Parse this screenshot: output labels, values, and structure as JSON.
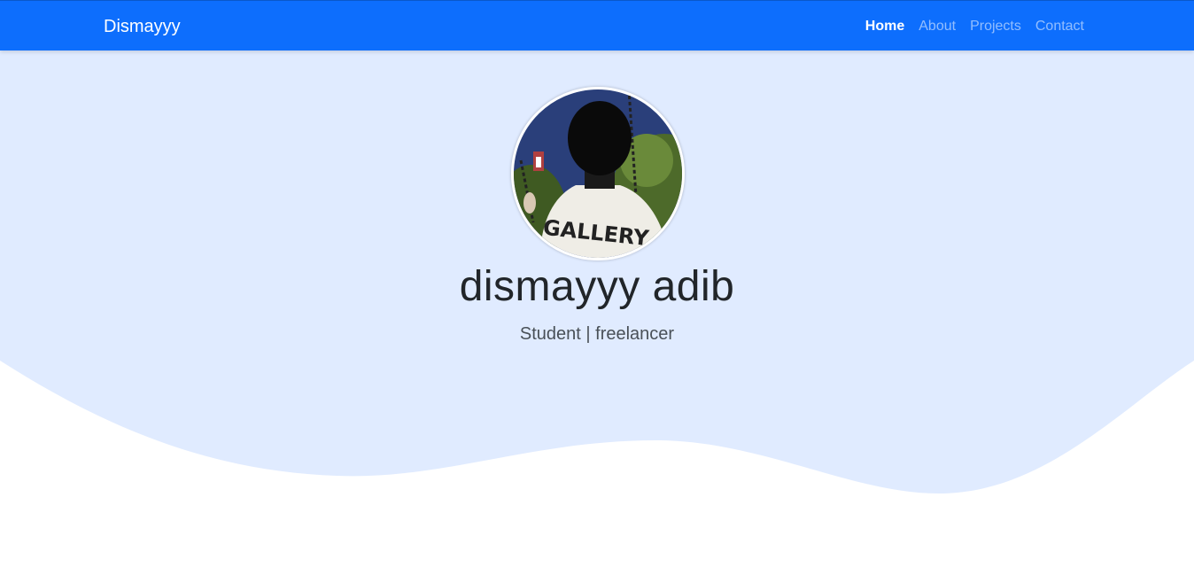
{
  "navbar": {
    "brand": "Dismayyy",
    "links": [
      {
        "label": "Home",
        "active": true
      },
      {
        "label": "About",
        "active": false
      },
      {
        "label": "Projects",
        "active": false
      },
      {
        "label": "Contact",
        "active": false
      }
    ]
  },
  "hero": {
    "name": "dismayyy adib",
    "tagline": "Student | freelancer",
    "avatar_shirt_text": "GALLERY"
  },
  "colors": {
    "navbar_bg": "#0d6efd",
    "hero_bg": "#e0ebff",
    "page_bg": "#ffffff"
  }
}
